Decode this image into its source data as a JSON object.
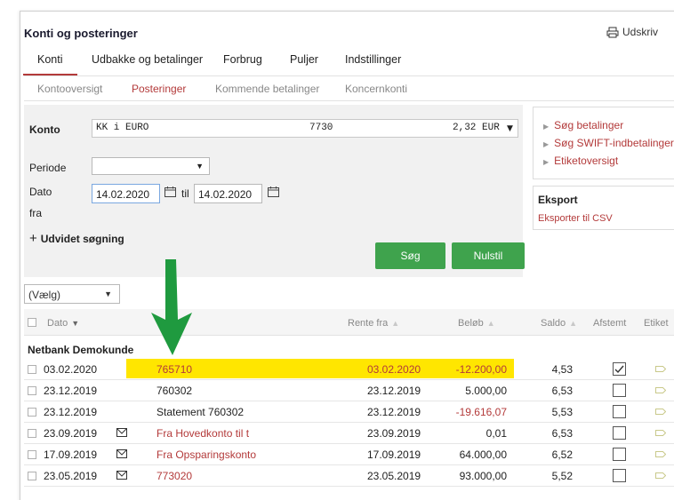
{
  "page": {
    "title": "Konti og posteringer",
    "print_label": "Udskriv"
  },
  "tabs": [
    {
      "label": "Konti",
      "active": true
    },
    {
      "label": "Udbakke og betalinger",
      "active": false
    },
    {
      "label": "Forbrug",
      "active": false
    },
    {
      "label": "Puljer",
      "active": false
    },
    {
      "label": "Indstillinger",
      "active": false
    }
  ],
  "subtabs": [
    {
      "label": "Kontooversigt",
      "active": false
    },
    {
      "label": "Posteringer",
      "active": true
    },
    {
      "label": "Kommende betalinger",
      "active": false
    },
    {
      "label": "Koncernkonti",
      "active": false
    }
  ],
  "form": {
    "konto_label": "Konto",
    "konto_name": "KK i EURO",
    "konto_number": "7730",
    "konto_balance": "2,32 EUR",
    "periode_label": "Periode",
    "periode_value": "",
    "dato_label": "Dato",
    "fra_label": "fra",
    "date_from": "14.02.2020",
    "til_label": "til",
    "date_to": "14.02.2020",
    "udvidet_label": "Udvidet søgning",
    "search_button": "Søg",
    "reset_button": "Nulstil"
  },
  "sidebar": {
    "links": [
      "Søg betalinger",
      "Søg SWIFT-indbetalinger",
      "Etiketoversigt"
    ],
    "eksport_title": "Eksport",
    "eksport_link": "Eksporter til CSV"
  },
  "table": {
    "filter_value": "(Vælg)",
    "columns": {
      "dato": "Dato",
      "rente_fra": "Rente fra",
      "beloeb": "Beløb",
      "saldo": "Saldo",
      "afstemt": "Afstemt",
      "etiket": "Etiket"
    },
    "group_name": "Netbank Demokunde",
    "rows": [
      {
        "date": "03.02.2020",
        "mail": false,
        "text": "765710",
        "text_red": true,
        "rente": "03.02.2020",
        "rente_red": true,
        "amount": "-12.200,00",
        "amount_red": true,
        "saldo": "4,53",
        "afstemt": true,
        "highlight": true
      },
      {
        "date": "23.12.2019",
        "mail": false,
        "text": "760302",
        "text_red": false,
        "rente": "23.12.2019",
        "rente_red": false,
        "amount": "5.000,00",
        "amount_red": false,
        "saldo": "6,53",
        "afstemt": false,
        "highlight": false
      },
      {
        "date": "23.12.2019",
        "mail": false,
        "text": "Statement 760302",
        "text_red": false,
        "rente": "23.12.2019",
        "rente_red": false,
        "amount": "-19.616,07",
        "amount_red": true,
        "saldo": "5,53",
        "afstemt": false,
        "highlight": false
      },
      {
        "date": "23.09.2019",
        "mail": true,
        "text": "Fra Hovedkonto til t",
        "text_red": true,
        "rente": "23.09.2019",
        "rente_red": false,
        "amount": "0,01",
        "amount_red": false,
        "saldo": "6,53",
        "afstemt": false,
        "highlight": false
      },
      {
        "date": "17.09.2019",
        "mail": true,
        "text": "Fra Opsparingskonto",
        "text_red": true,
        "rente": "17.09.2019",
        "rente_red": false,
        "amount": "64.000,00",
        "amount_red": false,
        "saldo": "6,52",
        "afstemt": false,
        "highlight": false
      },
      {
        "date": "23.05.2019",
        "mail": true,
        "text": "773020",
        "text_red": true,
        "rente": "23.05.2019",
        "rente_red": false,
        "amount": "93.000,00",
        "amount_red": false,
        "saldo": "5,52",
        "afstemt": false,
        "highlight": false
      }
    ]
  },
  "colors": {
    "accent_red": "#b33a3a",
    "button_green": "#3fa34d",
    "highlight_yellow": "#ffe600",
    "arrow_green": "#1f9a3f"
  },
  "icons": {
    "print": "printer-icon",
    "calendar": "calendar-icon",
    "plus": "plus-icon",
    "mail": "envelope-icon",
    "tag": "tag-icon",
    "check": "checkmark-icon",
    "arrow": "down-arrow-graphic"
  }
}
